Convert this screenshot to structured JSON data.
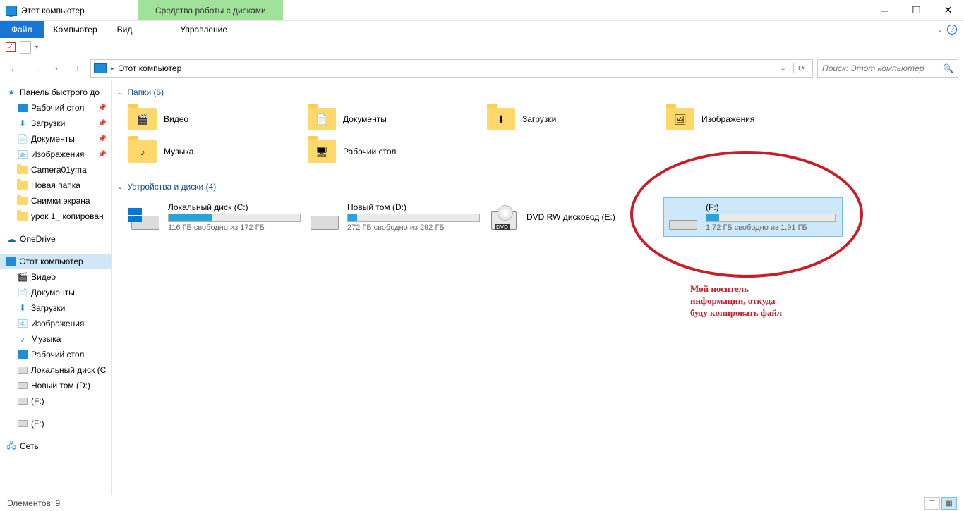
{
  "titlebar": {
    "title": "Этот компьютер",
    "ribbon_context": "Средства работы с дисками"
  },
  "menu": {
    "file": "Файл",
    "computer": "Компьютер",
    "view": "Вид",
    "manage": "Управление",
    "help_glyph": "?"
  },
  "nav": {
    "crumb": "Этот компьютер",
    "refresh_glyph": "⟳",
    "search_placeholder": "Поиск: Этот компьютер"
  },
  "sidebar": {
    "quick": "Панель быстрого до",
    "q_items": [
      {
        "label": "Рабочий стол",
        "pin": true,
        "icon": "desktop"
      },
      {
        "label": "Загрузки",
        "pin": true,
        "icon": "downloads"
      },
      {
        "label": "Документы",
        "pin": true,
        "icon": "docs"
      },
      {
        "label": "Изображения",
        "pin": true,
        "icon": "pics"
      },
      {
        "label": "Camera01yma",
        "pin": false,
        "icon": "folder"
      },
      {
        "label": "Новая папка",
        "pin": false,
        "icon": "folder"
      },
      {
        "label": "Снимки экрана",
        "pin": false,
        "icon": "folder"
      },
      {
        "label": "урок 1_ копирован",
        "pin": false,
        "icon": "folder"
      }
    ],
    "onedrive": "OneDrive",
    "thispc": "Этот компьютер",
    "pc_items": [
      {
        "label": "Видео",
        "icon": "video"
      },
      {
        "label": "Документы",
        "icon": "docs"
      },
      {
        "label": "Загрузки",
        "icon": "downloads"
      },
      {
        "label": "Изображения",
        "icon": "pics"
      },
      {
        "label": "Музыка",
        "icon": "music"
      },
      {
        "label": "Рабочий стол",
        "icon": "desktop"
      },
      {
        "label": "Локальный диск (C",
        "icon": "disk"
      },
      {
        "label": "Новый том (D:)",
        "icon": "disk"
      },
      {
        "label": "(F:)",
        "icon": "disk"
      }
    ],
    "f_again": "(F:)",
    "network": "Сеть"
  },
  "groups": {
    "folders": {
      "title": "Папки (6)",
      "items": [
        {
          "label": "Видео",
          "badge": "🎬"
        },
        {
          "label": "Документы",
          "badge": "📄"
        },
        {
          "label": "Загрузки",
          "badge": "⬇"
        },
        {
          "label": "Изображения",
          "badge": "🖼"
        },
        {
          "label": "Музыка",
          "badge": "♪"
        },
        {
          "label": "Рабочий стол",
          "badge": "🖥"
        }
      ]
    },
    "drives": {
      "title": "Устройства и диски (4)",
      "items": [
        {
          "name": "Локальный диск (C:)",
          "free": "116 ГБ свободно из 172 ГБ",
          "fill": 33,
          "type": "win",
          "sel": false
        },
        {
          "name": "Новый том (D:)",
          "free": "272 ГБ свободно из 292 ГБ",
          "fill": 7,
          "type": "hdd",
          "sel": false
        },
        {
          "name": "DVD RW дисковод (E:)",
          "free": "",
          "fill": -1,
          "type": "dvd",
          "sel": false
        },
        {
          "name": "(F:)",
          "free": "1,72 ГБ свободно из 1,91 ГБ",
          "fill": 10,
          "type": "usb",
          "sel": true
        }
      ]
    }
  },
  "annotation": {
    "text": "Мой носитель\nинформации, откуда\nбуду копировать файл"
  },
  "status": {
    "text": "Элементов: 9"
  }
}
